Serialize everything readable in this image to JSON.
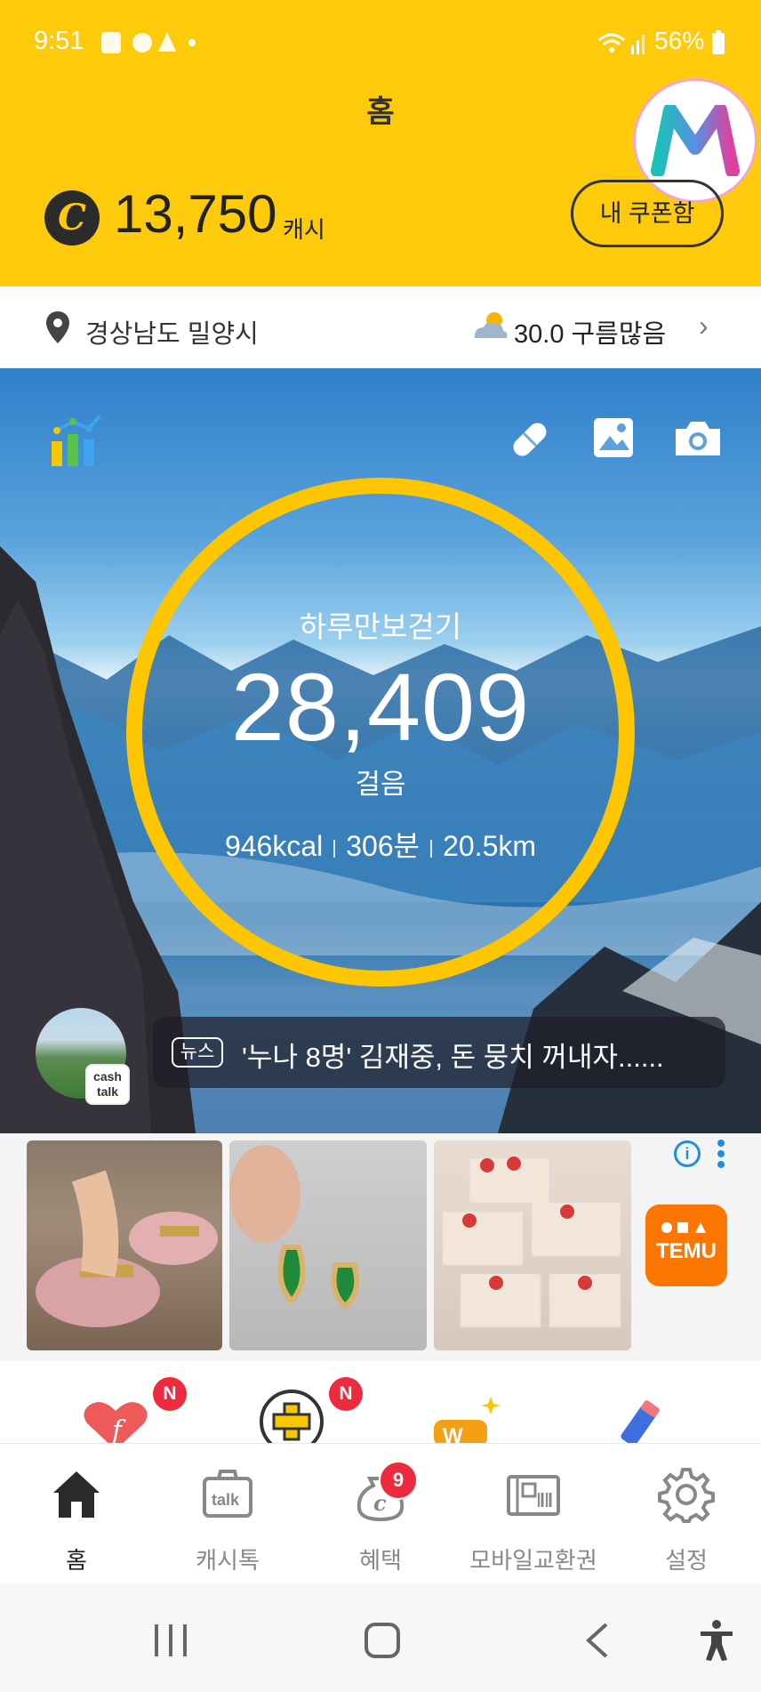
{
  "status_bar": {
    "time": "9:51",
    "battery": "56%"
  },
  "header": {
    "title": "홈",
    "coupon_button": "내 쿠폰함",
    "cash_amount": "13,750",
    "cash_unit": "캐시",
    "coin_symbol": "C"
  },
  "location": {
    "region": "경상남도 밀양시",
    "weather": "30.0 구름많음"
  },
  "walk": {
    "label": "하루만보걷기",
    "steps": "28,409",
    "unit": "걸음",
    "kcal": "946kcal",
    "minutes": "306분",
    "distance": "20.5km"
  },
  "news": {
    "tag": "뉴스",
    "headline": "'누나 8명' 김재중, 돈 뭉치 꺼내자......"
  },
  "cashtalk_badge": {
    "line1": "cash",
    "line2": "talk"
  },
  "ad": {
    "brand": "TEMU"
  },
  "shortcuts": {
    "badge1": "N",
    "badge2": "N"
  },
  "bottom_nav": [
    {
      "label": "홈",
      "active": true
    },
    {
      "label": "캐시톡",
      "active": false
    },
    {
      "label": "혜택",
      "active": false,
      "badge": "9"
    },
    {
      "label": "모바일교환권",
      "active": false
    },
    {
      "label": "설정",
      "active": false
    }
  ],
  "colors": {
    "brand_yellow": "#fdcb0c",
    "ring_yellow": "#fdc600",
    "badge_red": "#ee2b3e",
    "temu_orange": "#fb7701"
  }
}
